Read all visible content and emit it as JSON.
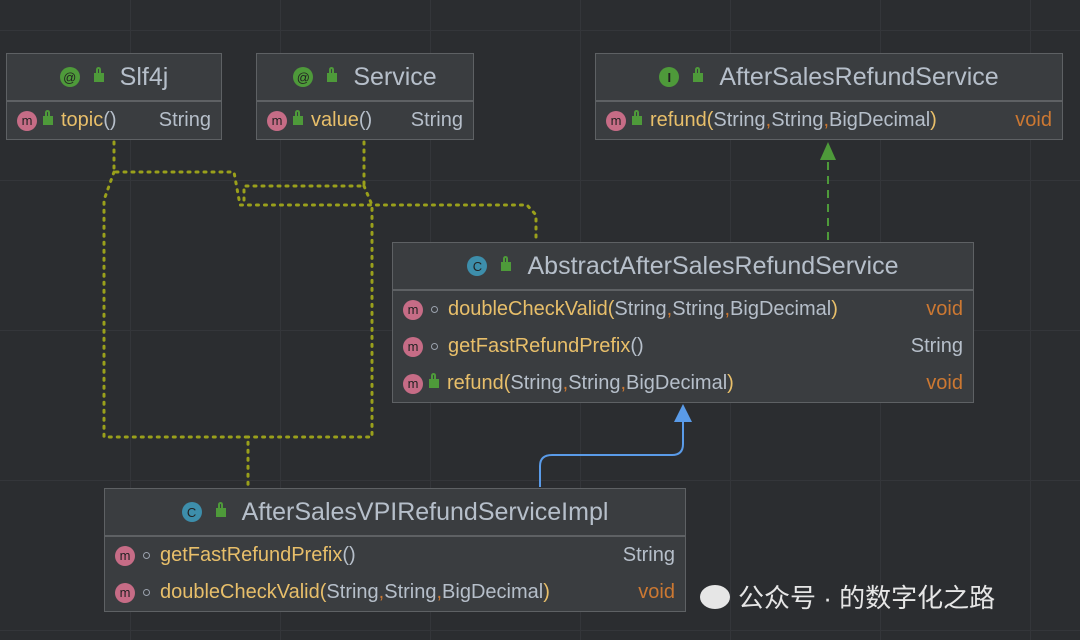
{
  "classes": [
    {
      "id": "slf4j",
      "kind": "annotation",
      "kind_icon": "@",
      "name": "Slf4j",
      "methods": [
        {
          "name": "topic",
          "params": "()",
          "ret": "String",
          "visibility": "public"
        }
      ]
    },
    {
      "id": "service",
      "kind": "annotation",
      "kind_icon": "@",
      "name": "Service",
      "methods": [
        {
          "name": "value",
          "params": "()",
          "ret": "String",
          "visibility": "public"
        }
      ]
    },
    {
      "id": "iface",
      "kind": "interface",
      "kind_icon": "I",
      "name": "AfterSalesRefundService",
      "methods": [
        {
          "name": "refund",
          "params": [
            "String",
            "String",
            "BigDecimal"
          ],
          "ret": "void",
          "visibility": "public"
        }
      ]
    },
    {
      "id": "abstract",
      "kind": "abstract-class",
      "kind_icon": "C",
      "name": "AbstractAfterSalesRefundService",
      "methods": [
        {
          "name": "doubleCheckValid",
          "params": [
            "String",
            "String",
            "BigDecimal"
          ],
          "ret": "void",
          "visibility": "package"
        },
        {
          "name": "getFastRefundPrefix",
          "params": "()",
          "ret": "String",
          "visibility": "package"
        },
        {
          "name": "refund",
          "params": [
            "String",
            "String",
            "BigDecimal"
          ],
          "ret": "void",
          "visibility": "public"
        }
      ]
    },
    {
      "id": "impl",
      "kind": "class",
      "kind_icon": "C",
      "name": "AfterSalesVPIRefundServiceImpl",
      "methods": [
        {
          "name": "getFastRefundPrefix",
          "params": "()",
          "ret": "String",
          "visibility": "package"
        },
        {
          "name": "doubleCheckValid",
          "params": [
            "String",
            "String",
            "BigDecimal"
          ],
          "ret": "void",
          "visibility": "package"
        }
      ]
    }
  ],
  "edges": [
    {
      "from": "abstract",
      "to": "iface",
      "type": "implements"
    },
    {
      "from": "impl",
      "to": "abstract",
      "type": "extends"
    },
    {
      "from": "abstract",
      "to": "slf4j",
      "type": "annotated"
    },
    {
      "from": "abstract",
      "to": "service",
      "type": "annotated"
    },
    {
      "from": "impl",
      "to": "slf4j",
      "type": "annotated"
    },
    {
      "from": "impl",
      "to": "service",
      "type": "annotated"
    }
  ],
  "watermark": {
    "text": "公众号 · 的数字化之路",
    "icon": "wechat-icon"
  },
  "colors": {
    "method": "#e8bf6a",
    "type": "#b6bfca",
    "keyword": "#cc7832",
    "annotation_edge": "#9aa01b",
    "implements_edge": "#4e9a3a",
    "extends_edge": "#5a9be8"
  }
}
